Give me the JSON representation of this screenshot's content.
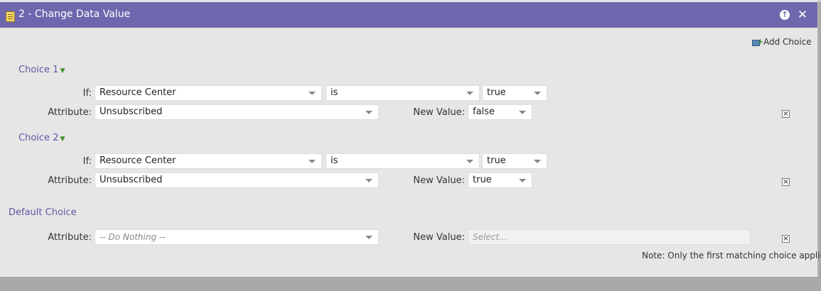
{
  "header": {
    "title": "2 - Change Data Value"
  },
  "toolbar": {
    "add_choice_label": "Add Choice"
  },
  "labels": {
    "if": "If:",
    "attribute": "Attribute:",
    "new_value": "New Value:"
  },
  "choices": [
    {
      "label": "Choice 1",
      "if_field": "Resource Center",
      "operator": "is",
      "condition_value": "true",
      "attribute": "Unsubscribed",
      "new_value": "false"
    },
    {
      "label": "Choice 2",
      "if_field": "Resource Center",
      "operator": "is",
      "condition_value": "true",
      "attribute": "Unsubscribed",
      "new_value": "true"
    }
  ],
  "default_choice": {
    "label": "Default Choice",
    "attribute": "-- Do Nothing --",
    "new_value_placeholder": "Select..."
  },
  "note": "Note: Only the first matching choice applies"
}
